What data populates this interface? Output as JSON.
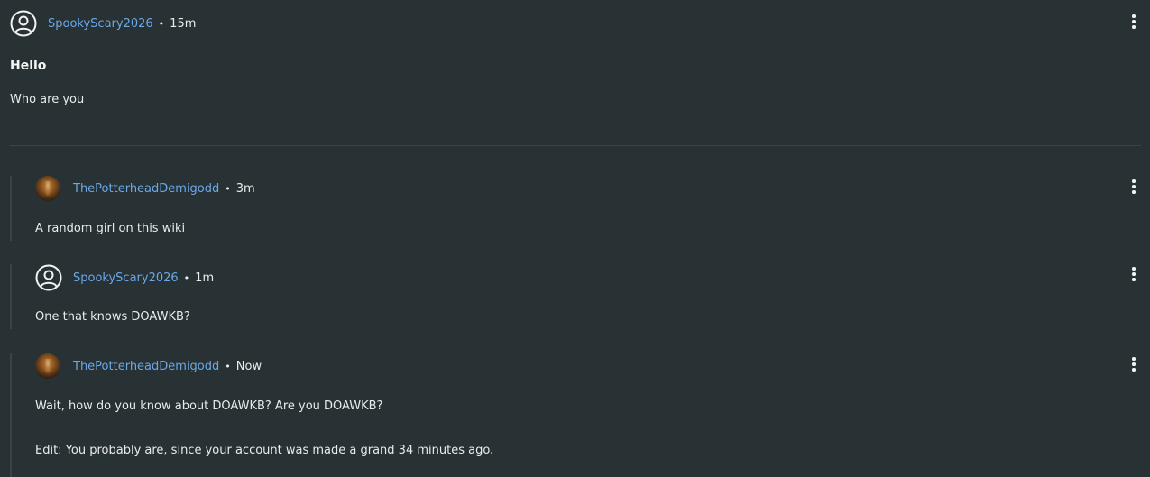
{
  "post": {
    "author": "SpookyScary2026",
    "time": "15m",
    "title": "Hello",
    "body": "Who are you"
  },
  "replies": [
    {
      "author": "ThePotterheadDemigodd",
      "time": "3m",
      "body": "A random girl on this wiki",
      "avatar": "image"
    },
    {
      "author": "SpookyScary2026",
      "time": "1m",
      "body": "One that knows DOAWKB?",
      "avatar": "default"
    },
    {
      "author": "ThePotterheadDemigodd",
      "time": "Now",
      "body": "Wait, how do you know about DOAWKB? Are you DOAWKB?",
      "body2": "Edit: You probably are, since your account was made a grand 34 minutes ago.",
      "avatar": "image"
    }
  ],
  "separator": "•"
}
